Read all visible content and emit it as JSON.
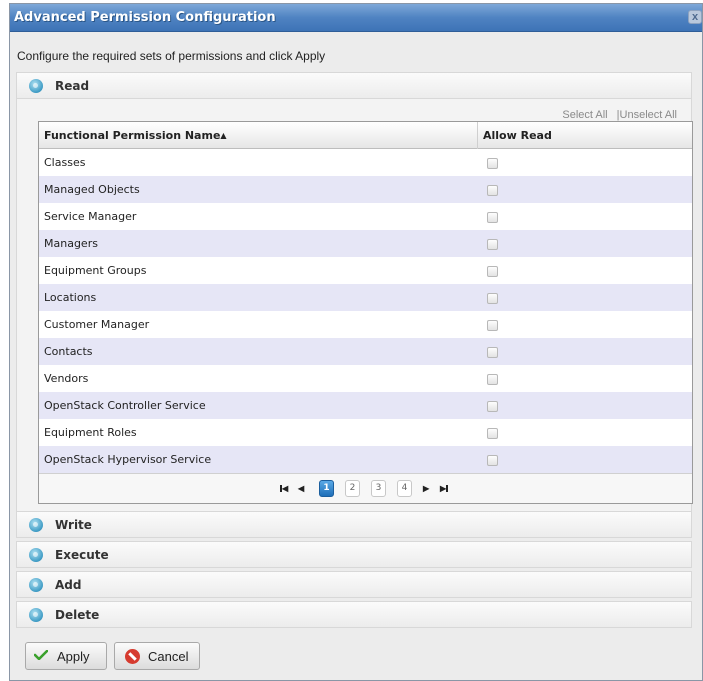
{
  "dialog": {
    "title": "Advanced Permission Configuration",
    "close_glyph": "x",
    "intro": "Configure the required sets of permissions and click Apply"
  },
  "sections": {
    "read": {
      "label": "Read",
      "icon": "expand-circle-icon"
    },
    "write": {
      "label": "Write",
      "icon": "expand-circle-icon"
    },
    "execute": {
      "label": "Execute",
      "icon": "expand-circle-icon"
    },
    "add": {
      "label": "Add",
      "icon": "expand-circle-icon"
    },
    "delete": {
      "label": "Delete",
      "icon": "expand-circle-icon"
    }
  },
  "selection": {
    "select_all": "Select All",
    "unselect_all": "|Unselect All"
  },
  "grid": {
    "col_name": "Functional Permission Name",
    "sort_glyph": "▲",
    "col_allow": "Allow Read",
    "rows": [
      {
        "name": "Classes",
        "checked": false
      },
      {
        "name": "Managed Objects",
        "checked": false
      },
      {
        "name": "Service Manager",
        "checked": false
      },
      {
        "name": "Managers",
        "checked": false
      },
      {
        "name": "Equipment Groups",
        "checked": false
      },
      {
        "name": "Locations",
        "checked": false
      },
      {
        "name": "Customer Manager",
        "checked": false
      },
      {
        "name": "Contacts",
        "checked": false
      },
      {
        "name": "Vendors",
        "checked": false
      },
      {
        "name": "OpenStack Controller Service",
        "checked": false
      },
      {
        "name": "Equipment Roles",
        "checked": false
      },
      {
        "name": "OpenStack Hypervisor Service",
        "checked": false
      }
    ]
  },
  "pager": {
    "first": "◀",
    "prev": "◀",
    "pages": [
      "1",
      "2",
      "3",
      "4"
    ],
    "current": "1",
    "next": "▶",
    "last": "▶"
  },
  "buttons": {
    "apply": "Apply",
    "cancel": "Cancel"
  },
  "colors": {
    "title_bar": "#4f83c2",
    "alt_row": "#e6e6f6",
    "current_page": "#1f6fb8",
    "cancel_icon": "#d63b2f",
    "apply_icon": "#3aa12c"
  }
}
